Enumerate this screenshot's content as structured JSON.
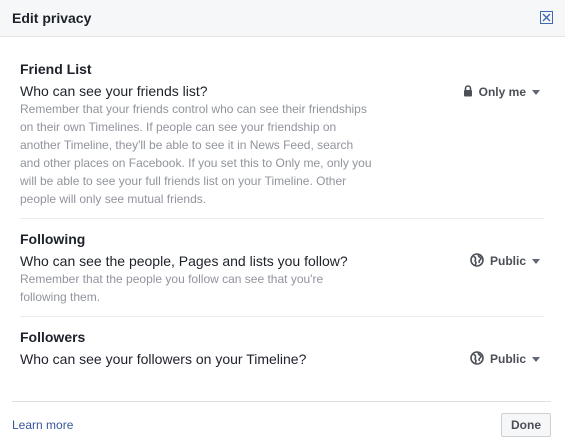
{
  "dialog": {
    "title": "Edit privacy",
    "close_icon": "close-icon"
  },
  "sections": [
    {
      "title": "Friend List",
      "question": "Who can see your friends list?",
      "description": "Remember that your friends control who can see their friendships on their own Timelines. If people can see your friendship on another Timeline, they'll be able to see it in News Feed, search and other places on Facebook. If you set this to Only me, only you will be able to see your full friends list on your Timeline. Other people will only see mutual friends.",
      "audience": {
        "label": "Only me",
        "icon": "lock-icon"
      }
    },
    {
      "title": "Following",
      "question": "Who can see the people, Pages and lists you follow?",
      "description": "Remember that the people you follow can see that you're following them.",
      "audience": {
        "label": "Public",
        "icon": "globe-icon"
      }
    },
    {
      "title": "Followers",
      "question": "Who can see your followers on your Timeline?",
      "description": "",
      "audience": {
        "label": "Public",
        "icon": "globe-icon"
      }
    }
  ],
  "footer": {
    "learn_more": "Learn more",
    "done": "Done"
  },
  "colors": {
    "link": "#365899",
    "close_border": "#4267b2",
    "muted_text": "#90949c"
  }
}
